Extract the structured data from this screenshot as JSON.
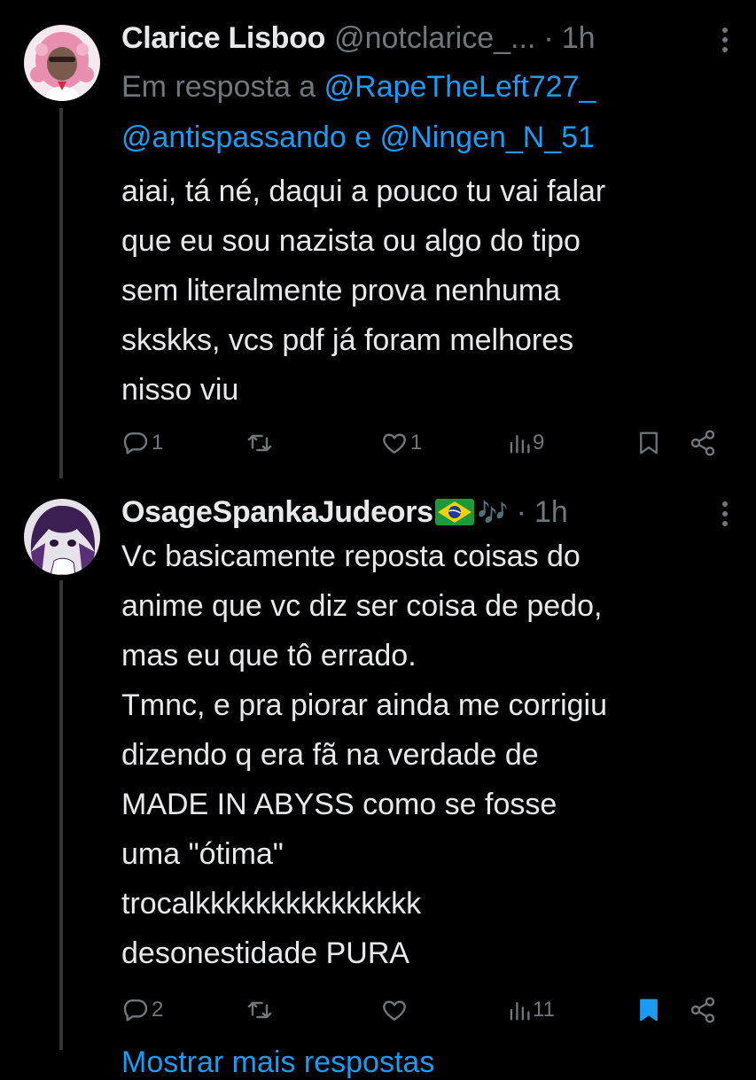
{
  "tweets": [
    {
      "author_name": "Clarice Lisboo",
      "author_handle": "@notclarice_...",
      "separator": "·",
      "time": "1h",
      "reply_prefix": "Em resposta a",
      "reply_mention_1": "@RapeTheLeft727_",
      "reply_mention_2": "@antispassando",
      "reply_conjunction": "e",
      "reply_mention_3": "@Ningen_N_51",
      "text": "aiai, tá né, daqui a pouco tu vai falar\nque eu sou nazista ou algo do tipo\nsem literalmente prova nenhuma\nskskks, vcs pdf já foram melhores\nnisso viu",
      "replies": "1",
      "retweets": "",
      "likes": "1",
      "views": "9",
      "bookmarked": false
    },
    {
      "author_name": "OsageSpankaJudeors",
      "author_emoji": "🎶",
      "separator": "·",
      "time": "1h",
      "text": "Vc basicamente reposta coisas do\nanime que vc diz ser coisa de pedo,\nmas eu que tô errado.\nTmnc, e pra piorar ainda me corrigiu\ndizendo q era fã na verdade de\nMADE IN ABYSS como se fosse\numa \"ótima\"\ntrocalkkkkkkkkkkkkkkk\ndesonestidade PURA",
      "replies": "2",
      "retweets": "",
      "likes": "",
      "views": "11",
      "bookmarked": true
    }
  ],
  "icons": {
    "reply": "reply-icon",
    "retweet": "retweet-icon",
    "like": "heart-icon",
    "views": "views-icon",
    "bookmark": "bookmark-icon",
    "share": "share-icon",
    "more": "more-vertical-icon",
    "flag": "brazil-flag-icon"
  },
  "colors": {
    "background": "#000000",
    "primary_text": "#e7e9ea",
    "secondary_text": "#71767b",
    "accent": "#1d9bf0",
    "thread_line": "#333639"
  },
  "more_replies_label": "Mostrar mais respostas"
}
